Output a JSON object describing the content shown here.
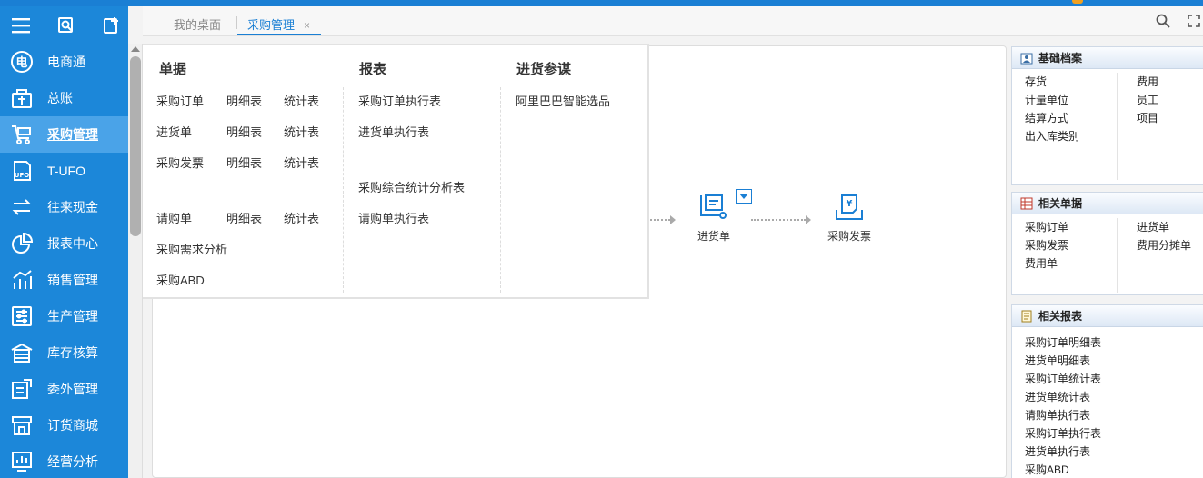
{
  "sidebar": {
    "items": [
      {
        "label": "电商通",
        "icon": "ecommerce-icon"
      },
      {
        "label": "总账",
        "icon": "ledger-icon"
      },
      {
        "label": "采购管理",
        "icon": "cart-icon",
        "active": true
      },
      {
        "label": "T-UFO",
        "icon": "ufo-icon"
      },
      {
        "label": "往来现金",
        "icon": "exchange-icon"
      },
      {
        "label": "报表中心",
        "icon": "pie-chart-icon"
      },
      {
        "label": "销售管理",
        "icon": "sales-chart-icon"
      },
      {
        "label": "生产管理",
        "icon": "production-icon"
      },
      {
        "label": "库存核算",
        "icon": "warehouse-icon"
      },
      {
        "label": "委外管理",
        "icon": "outsourcing-icon"
      },
      {
        "label": "订货商城",
        "icon": "store-icon"
      },
      {
        "label": "经营分析",
        "icon": "analysis-icon"
      }
    ]
  },
  "tabs": {
    "desktop": "我的桌面",
    "purchase": "采购管理",
    "close": "×"
  },
  "menu": {
    "col1_title": "单据",
    "col2_title": "报表",
    "col3_title": "进货参谋",
    "col1": {
      "po": "采购订单",
      "po_detail": "明细表",
      "po_stat": "统计表",
      "gr": "进货单",
      "gr_detail": "明细表",
      "gr_stat": "统计表",
      "inv": "采购发票",
      "inv_detail": "明细表",
      "inv_stat": "统计表",
      "req": "请购单",
      "req_detail": "明细表",
      "req_stat": "统计表",
      "demand": "采购需求分析",
      "abd": "采购ABD"
    },
    "col2": {
      "po_exec": "采购订单执行表",
      "gr_exec": "进货单执行表",
      "summary": "采购综合统计分析表",
      "req_exec": "请购单执行表"
    },
    "col3": {
      "alibaba": "阿里巴巴智能选品"
    }
  },
  "flow": {
    "goods_receipt": "进货单",
    "purchase_invoice": "采购发票"
  },
  "panels": {
    "basic": {
      "title": "基础档案",
      "left": [
        "存货",
        "计量单位",
        "结算方式",
        "出入库类别"
      ],
      "right": [
        "费用",
        "员工",
        "项目"
      ]
    },
    "related_docs": {
      "title": "相关单据",
      "left": [
        "采购订单",
        "采购发票",
        "费用单"
      ],
      "right": [
        "进货单",
        "费用分摊单"
      ]
    },
    "related_reports": {
      "title": "相关报表",
      "items": [
        "采购订单明细表",
        "进货单明细表",
        "采购订单统计表",
        "进货单统计表",
        "请购单执行表",
        "采购订单执行表",
        "进货单执行表",
        "采购ABD"
      ]
    }
  },
  "colors": {
    "sidebar": "#1c87d9",
    "accent": "#1a7fd4",
    "active": "#4aa3e8"
  }
}
